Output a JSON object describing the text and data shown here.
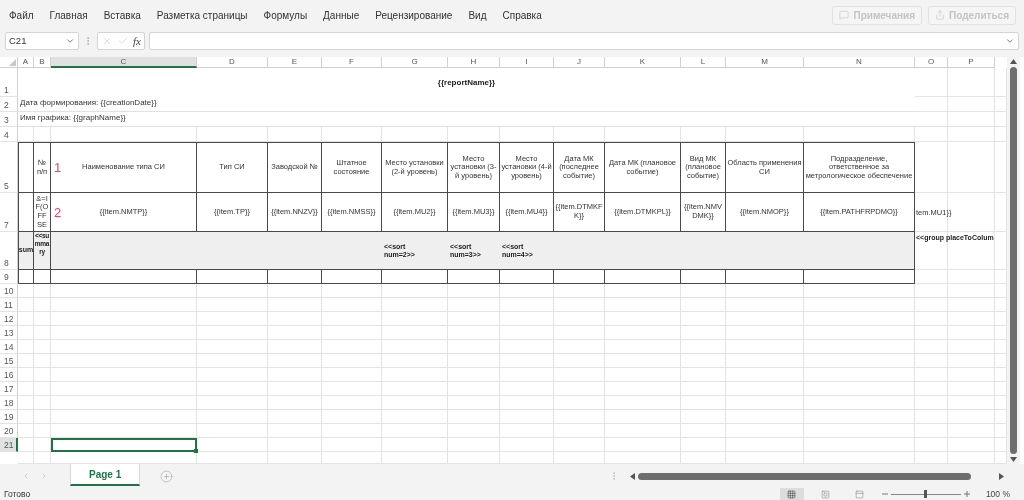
{
  "menu": [
    {
      "label": "Файл"
    },
    {
      "label": "Главная"
    },
    {
      "label": "Вставка"
    },
    {
      "label": "Разметка страницы"
    },
    {
      "label": "Формулы"
    },
    {
      "label": "Данные"
    },
    {
      "label": "Рецензирование"
    },
    {
      "label": "Вид"
    },
    {
      "label": "Справка"
    }
  ],
  "buttons": [
    {
      "kind": "comments",
      "label": "Примечания",
      "disabled": true
    },
    {
      "kind": "share",
      "label": "Поделиться",
      "disabled": true
    }
  ],
  "formula_bar": {
    "name_box": "C21",
    "function_label": "fx"
  },
  "columns": [
    {
      "label": "A",
      "selected": false
    },
    {
      "label": "B",
      "selected": false
    },
    {
      "label": "C",
      "selected": true
    },
    {
      "label": "D",
      "selected": false
    },
    {
      "label": "E",
      "selected": false
    },
    {
      "label": "F",
      "selected": false
    },
    {
      "label": "G",
      "selected": false
    },
    {
      "label": "H",
      "selected": false
    },
    {
      "label": "I",
      "selected": false
    },
    {
      "label": "J",
      "selected": false
    },
    {
      "label": "K",
      "selected": false
    },
    {
      "label": "L",
      "selected": false
    },
    {
      "label": "M",
      "selected": false
    },
    {
      "label": "N",
      "selected": false
    },
    {
      "label": "O",
      "selected": false
    },
    {
      "label": "P",
      "selected": false
    }
  ],
  "rows": [
    {
      "label": "1",
      "selected": false,
      "kind": "title",
      "title": "{{reportName}}"
    },
    {
      "label": "2",
      "selected": false,
      "kind": "note",
      "text": "Дата формирования: {{creationDate}}"
    },
    {
      "label": "3",
      "selected": false,
      "kind": "note",
      "text": "Имя графика: {{graphName}}"
    },
    {
      "label": "4",
      "selected": false,
      "kind": "empty"
    },
    {
      "label": "5",
      "selected": false,
      "kind": "header",
      "cells": [
        {
          "text": "№ п/п"
        },
        {
          "text": "Наименование типа СИ",
          "marker": "1"
        },
        {
          "text": "Тип СИ"
        },
        {
          "text": "Заводской №"
        },
        {
          "text": "Штатное состояние"
        },
        {
          "text": "Место установки (2-й уровень)"
        },
        {
          "text": "Место установки (3-й уровень)"
        },
        {
          "text": "Место установки (4-й уровень)"
        },
        {
          "text": "Дата МК (последнее событие)"
        },
        {
          "text": "Дата МК (плановое событие)"
        },
        {
          "text": "Вид МК (плановое событие)"
        },
        {
          "text": "Область применения СИ"
        },
        {
          "text": "Подразделение, ответственное за метрологическое обеспечение"
        }
      ]
    },
    {
      "label": "7",
      "selected": false,
      "kind": "data",
      "overflow": "tem.MU1}}",
      "cells": [
        {
          "text": "&=IF(OFFSE"
        },
        {
          "text": "{{item.NMTP}}",
          "marker": "2"
        },
        {
          "text": "{{item.TP}}"
        },
        {
          "text": "{{item.NNZV}}"
        },
        {
          "text": "{{item.NMSS}}"
        },
        {
          "text": "{{item.MU2}}"
        },
        {
          "text": "{{item.MU3}}"
        },
        {
          "text": "{{item.MU4}}"
        },
        {
          "text": "{{item.DTMKFK}}"
        },
        {
          "text": "{{item.DTMKPL}}"
        },
        {
          "text": "{{item.NMVDMK}}"
        },
        {
          "text": "{{item.NMOP}}"
        },
        {
          "text": "{{item.PATHFRPDMO}}"
        }
      ]
    },
    {
      "label": "8",
      "selected": false,
      "kind": "band",
      "overflow": "<<group placeToColum",
      "cells": [
        {
          "text": "sum"
        },
        {
          "text": "<<summary"
        }
      ],
      "sorts": [
        {
          "text": "<<sort num=2>>"
        },
        {
          "text": "<<sort num=3>>"
        },
        {
          "text": "<<sort num=4>>"
        }
      ]
    },
    {
      "label": "9",
      "selected": false,
      "kind": "blank"
    },
    {
      "label": "10",
      "selected": false,
      "kind": "empty"
    },
    {
      "label": "11",
      "selected": false,
      "kind": "empty"
    },
    {
      "label": "12",
      "selected": false,
      "kind": "empty"
    },
    {
      "label": "13",
      "selected": false,
      "kind": "empty"
    },
    {
      "label": "14",
      "selected": false,
      "kind": "empty"
    },
    {
      "label": "15",
      "selected": false,
      "kind": "empty"
    },
    {
      "label": "16",
      "selected": false,
      "kind": "empty"
    },
    {
      "label": "17",
      "selected": false,
      "kind": "empty"
    },
    {
      "label": "18",
      "selected": false,
      "kind": "empty"
    },
    {
      "label": "19",
      "selected": false,
      "kind": "empty"
    },
    {
      "label": "20",
      "selected": false,
      "kind": "empty"
    },
    {
      "label": "21",
      "selected": true,
      "kind": "empty"
    }
  ],
  "sheet_tabs": [
    {
      "label": "Page 1",
      "selected": true
    }
  ],
  "status_bar": {
    "text": "Готово"
  },
  "views": [
    {
      "kind": "normal",
      "selected": true
    },
    {
      "kind": "page-layout",
      "selected": false
    },
    {
      "kind": "page-break",
      "selected": false
    }
  ],
  "zoom": {
    "level": 0.5,
    "reading": "100 %"
  }
}
